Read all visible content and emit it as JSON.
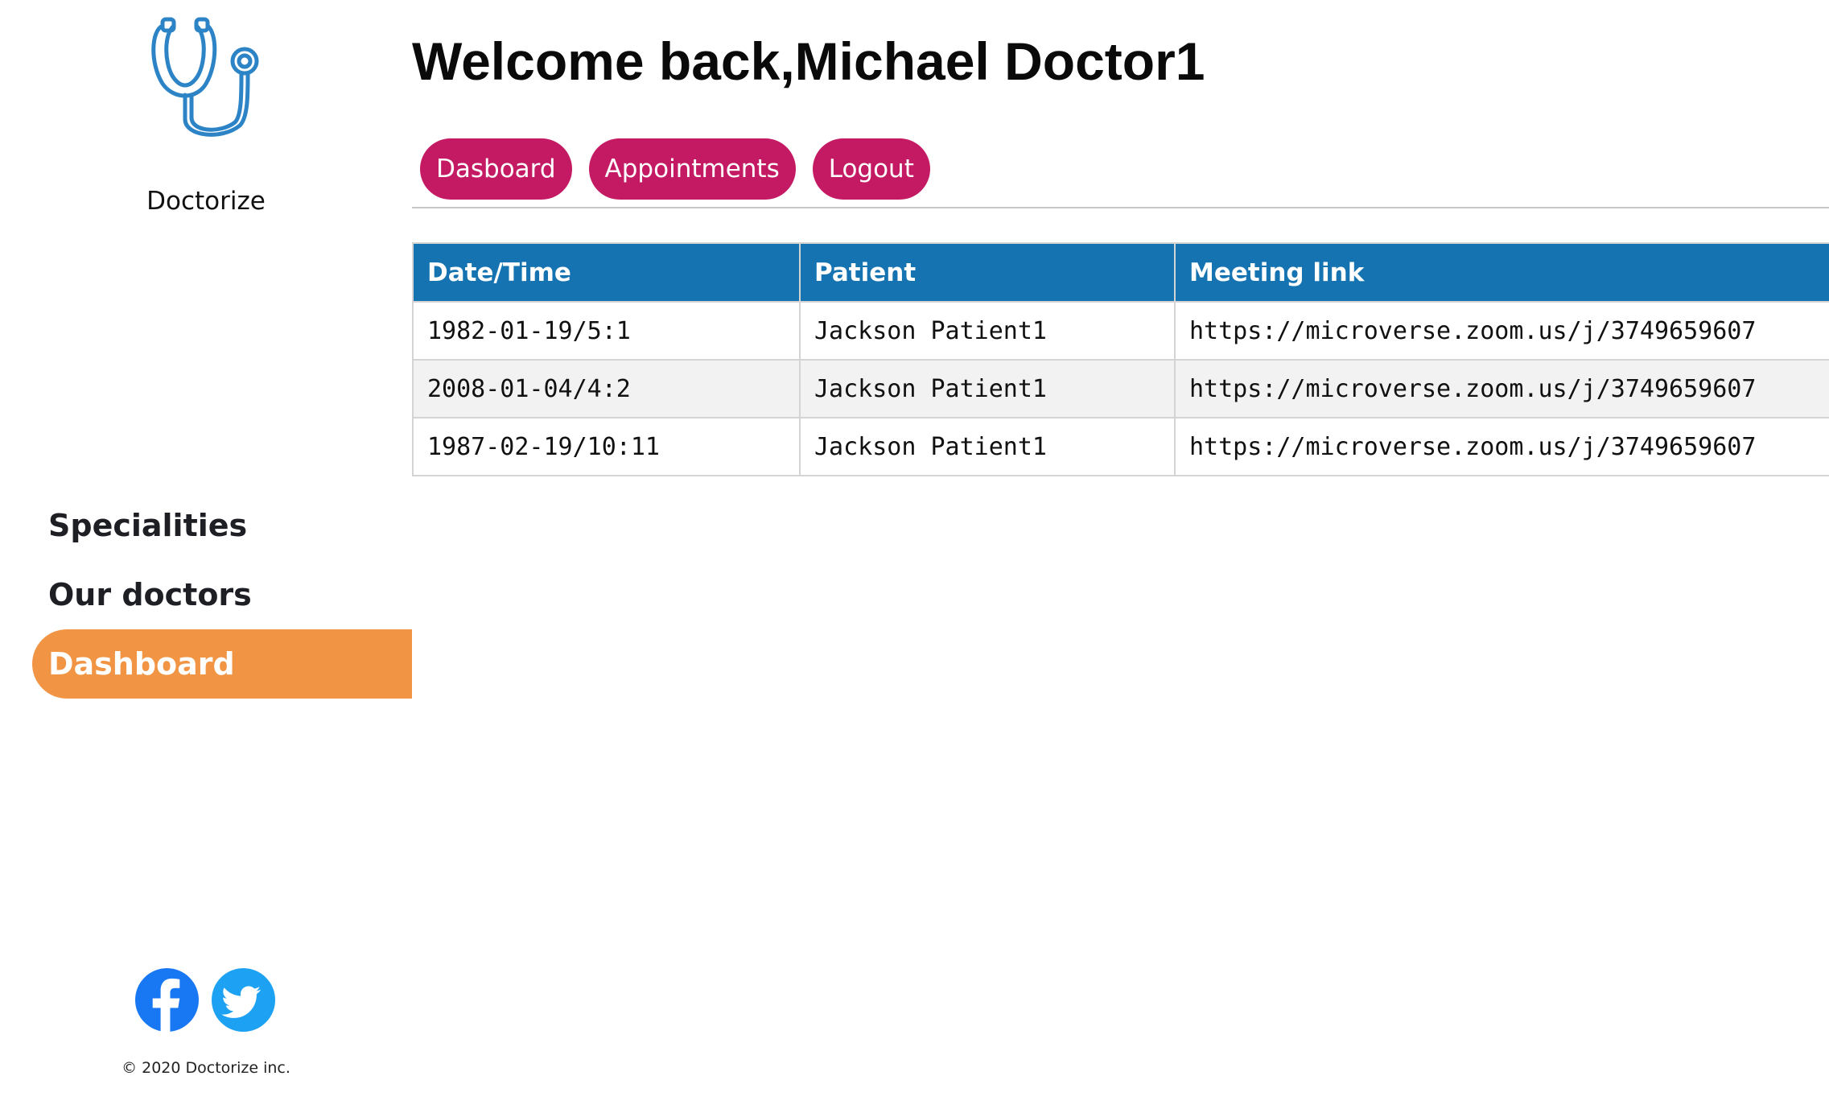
{
  "brand": {
    "name": "Doctorize",
    "logo_icon": "stethoscope-icon",
    "logo_color": "#2c84c6"
  },
  "sidebar": {
    "items": [
      {
        "label": "Specialities",
        "active": false
      },
      {
        "label": "Our doctors",
        "active": false
      },
      {
        "label": "Dashboard",
        "active": true
      }
    ],
    "active_color": "#f19443",
    "socials": [
      {
        "icon": "facebook-icon",
        "color": "#1877f2"
      },
      {
        "icon": "twitter-icon",
        "color": "#1da1f2"
      }
    ],
    "copyright": "© 2020 Doctorize inc."
  },
  "header": {
    "welcome_prefix": "Welcome back,",
    "user_name": "Michael Doctor1"
  },
  "toolbar": {
    "buttons": [
      {
        "label": "Dasboard"
      },
      {
        "label": "Appointments"
      },
      {
        "label": "Logout"
      }
    ],
    "button_color": "#c41a64"
  },
  "appointments": {
    "header_color": "#1473b0",
    "columns": [
      "Date/Time",
      "Patient",
      "Meeting link"
    ],
    "rows": [
      [
        "1982-01-19/5:1",
        "Jackson Patient1",
        "https://microverse.zoom.us/j/3749659607"
      ],
      [
        "2008-01-04/4:2",
        "Jackson Patient1",
        "https://microverse.zoom.us/j/3749659607"
      ],
      [
        "1987-02-19/10:11",
        "Jackson Patient1",
        "https://microverse.zoom.us/j/3749659607"
      ]
    ]
  }
}
